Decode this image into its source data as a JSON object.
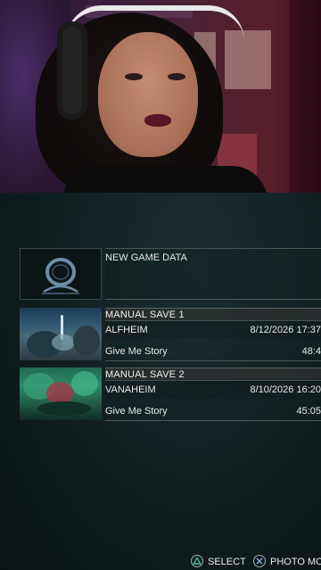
{
  "game_ui": {
    "new_game": {
      "label": "NEW GAME DATA"
    },
    "saves": [
      {
        "header": "MANUAL SAVE 1",
        "realm": "ALFHEIM",
        "datetime": "8/12/2026 17:37",
        "difficulty": "Give Me Story",
        "playtime": "48:4"
      },
      {
        "header": "MANUAL SAVE 2",
        "realm": "VANAHEIM",
        "datetime": "8/10/2026 16:20",
        "difficulty": "Give Me Story",
        "playtime": "45:05"
      }
    ],
    "prompts": {
      "select": {
        "icon": "triangle-button-icon",
        "label": "SELECT"
      },
      "photo": {
        "icon": "cross-button-icon",
        "label": "PHOTO MO"
      }
    }
  }
}
